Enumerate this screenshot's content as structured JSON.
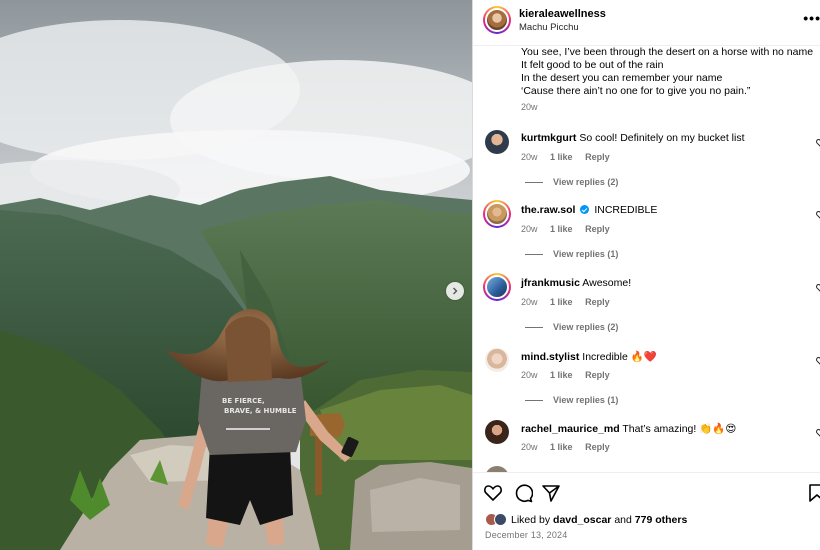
{
  "post": {
    "username": "kieraleawellness",
    "location": "Machu Picchu",
    "more_icon": "more-horizontal-icon"
  },
  "caption": {
    "lines": [
      "You see, I’ve been through the desert on a horse with no name",
      "It felt good to be out of the rain",
      "In the desert you can remember your name",
      "‘Cause there ain’t no one for to give you no pain.”"
    ],
    "age": "20w"
  },
  "comments": [
    {
      "username": "kurtmkgurt",
      "verified": false,
      "text": "So cool! Definitely on my bucket list",
      "age": "20w",
      "likes": "1 like",
      "reply": "Reply",
      "view_replies": "View replies (2)"
    },
    {
      "username": "the.raw.sol",
      "verified": true,
      "text": "INCREDIBLE",
      "age": "20w",
      "likes": "1 like",
      "reply": "Reply",
      "view_replies": "View replies (1)"
    },
    {
      "username": "jfrankmusic",
      "verified": false,
      "text": "Awesome!",
      "age": "20w",
      "likes": "1 like",
      "reply": "Reply",
      "view_replies": "View replies (2)"
    },
    {
      "username": "mind.stylist",
      "verified": false,
      "text": "Incredible 🔥❤️",
      "age": "20w",
      "likes": "1 like",
      "reply": "Reply",
      "view_replies": "View replies (1)"
    },
    {
      "username": "rachel_maurice_md",
      "verified": false,
      "text": "That’s amazing! 👏🔥😍",
      "age": "20w",
      "likes": "1 like",
      "reply": "Reply",
      "view_replies": ""
    }
  ],
  "likes": {
    "prefix": "Liked by",
    "user": "davd_oscar",
    "middle": "and",
    "count": "779 others"
  },
  "date": "December 13, 2024",
  "colors": {
    "link_blue": "#0095f6",
    "muted": "#737373"
  }
}
